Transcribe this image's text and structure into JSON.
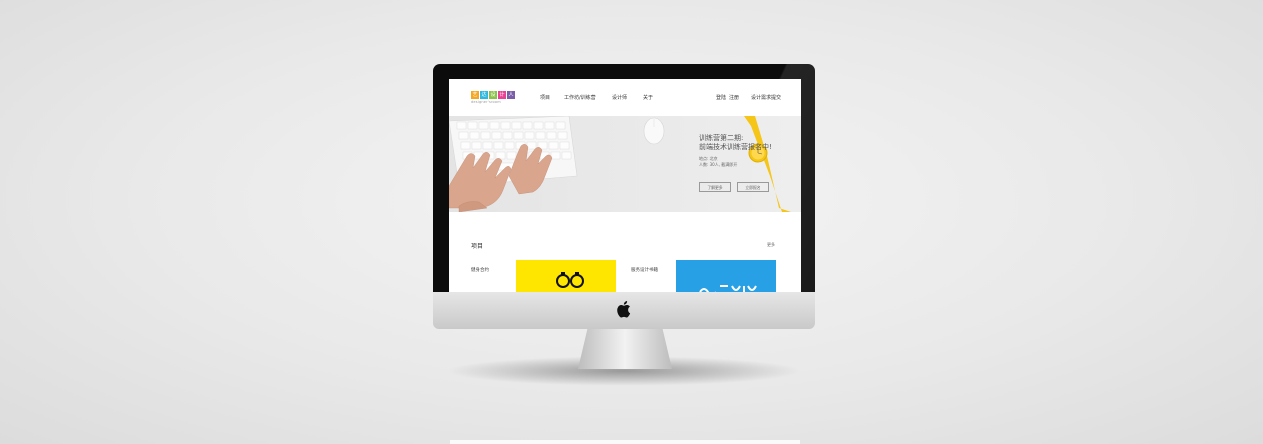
{
  "brand": {
    "logo_letters": [
      "艺",
      "达",
      "设",
      "计",
      "人"
    ],
    "logo_colors": [
      "#f5a623",
      "#2fb8e0",
      "#8bc34a",
      "#e84393",
      "#7b5ea7"
    ],
    "logo_subtitle": "designer'sroom"
  },
  "nav": {
    "items": [
      {
        "label": "项目"
      },
      {
        "label": "工作坊/训练营"
      },
      {
        "label": "设计师"
      },
      {
        "label": "关于"
      }
    ],
    "login_label": "登陆",
    "register_label": "注册",
    "action_label": "设计需求提交"
  },
  "hero": {
    "title_line1": "训练营第二期:",
    "title_line2": "前端技术训练营报名中!",
    "location": "地点: 北京",
    "people": "人数: 30人, 截满即开",
    "learn_more_label": "了解更多",
    "signup_label": "立即报名"
  },
  "projects": {
    "section_title": "项目",
    "more_label": "更多",
    "items": [
      {
        "label": "健身合约",
        "thumb_color": "#ffe600"
      },
      {
        "label": "服务设计书籍",
        "thumb_color": "#27a0e6"
      }
    ]
  },
  "colors": {
    "hero_bg": "#ebebeb",
    "watch_yellow": "#f5c518",
    "bezel": "#0c0c0c"
  }
}
